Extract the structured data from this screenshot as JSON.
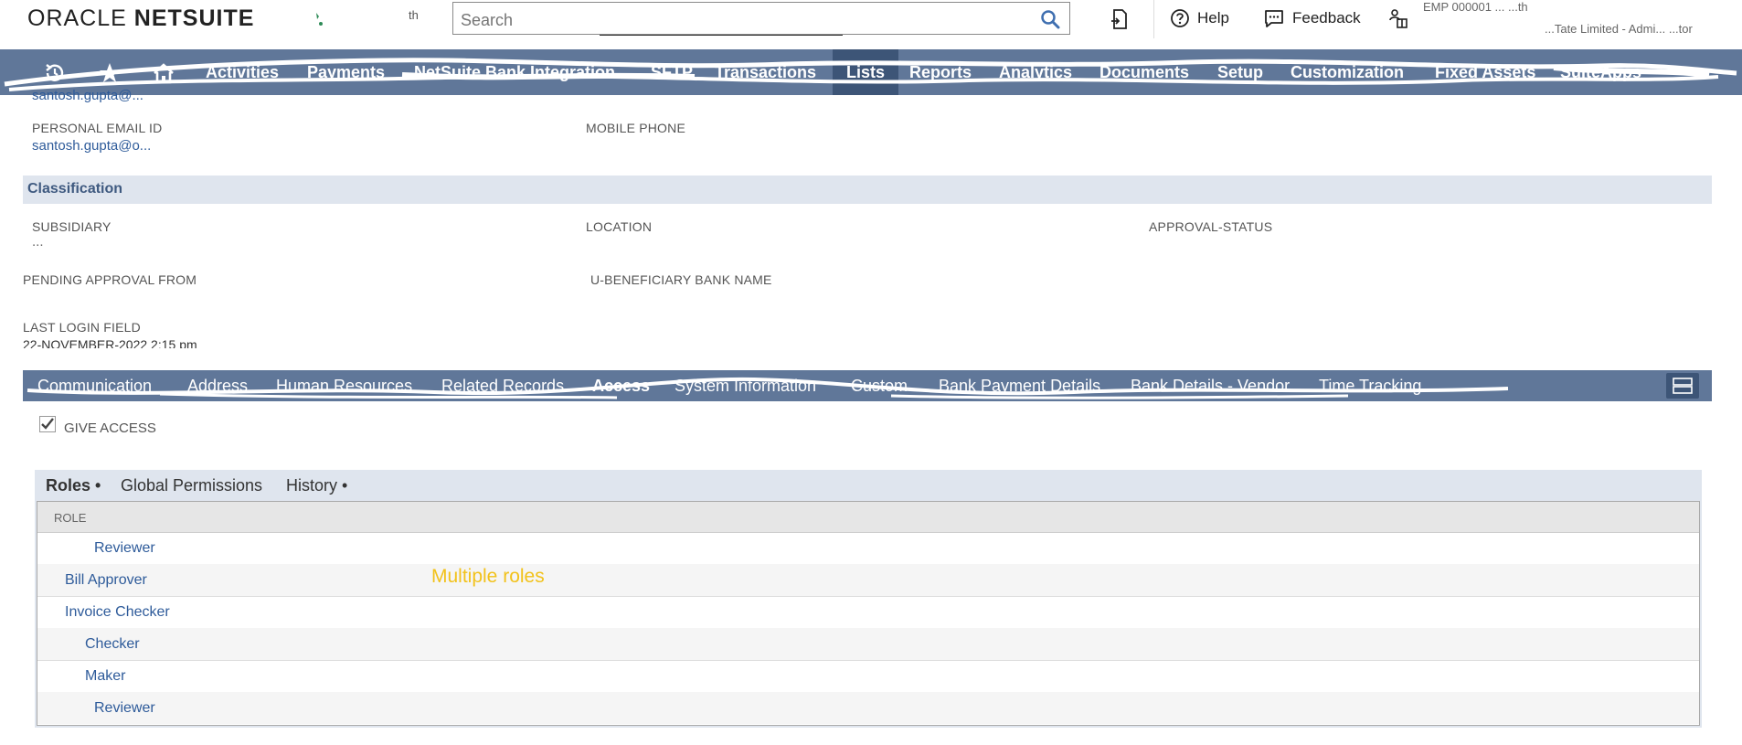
{
  "topbar": {
    "brand_regular": "ORACLE ",
    "brand_bold": "NETSUITE",
    "small_text": "th",
    "search_placeholder": "Search",
    "help_label": "Help",
    "feedback_label": "Feedback",
    "user_line1": "EMP 000001 ... ...th",
    "user_line2": "...Tate Limited - Admi... ...tor"
  },
  "nav": {
    "items": [
      "Activities",
      "Payments",
      "NetSuite Bank Integration",
      "SFTP",
      "Transactions",
      "Lists",
      "Reports",
      "Analytics",
      "Documents",
      "Setup",
      "Customization",
      "Fixed Assets",
      "SuiteApps"
    ],
    "active": "Lists",
    "more_label": "•••"
  },
  "fields": {
    "email_value_top": "santosh.gupta@...",
    "personal_email_label": "PERSONAL EMAIL ID",
    "personal_email_value": "santosh.gupta@o...",
    "mobile_phone_label": "MOBILE PHONE",
    "classification_label": "Classification",
    "subsidiary_label": "SUBSIDIARY",
    "subsidiary_value": "...",
    "location_label": "LOCATION",
    "approval_status_label": "APPROVAL-STATUS",
    "pending_approval_label": "PENDING APPROVAL FROM",
    "beneficiary_bank_label": "U-BENEFICIARY BANK NAME",
    "last_login_label": "LAST LOGIN FIELD",
    "last_login_value": "22-NOVEMBER-2022 2:15 pm"
  },
  "subtabs": {
    "items": [
      "Communication",
      "Address",
      "Human Resources",
      "Related Records",
      "Access",
      "System Information",
      "Custom",
      "Bank Payment Details",
      "Bank Details - Vendor",
      "Time Tracking"
    ],
    "active": "Access"
  },
  "access": {
    "give_access_label": "GIVE ACCESS",
    "give_access_checked": true,
    "panel_tabs": [
      "Roles •",
      "Global Permissions",
      "History •"
    ],
    "active_panel_tab": "Roles •",
    "role_column_header": "ROLE",
    "roles": [
      "Reviewer",
      "Bill Approver",
      "Invoice Checker",
      "Checker",
      "Maker",
      "Reviewer"
    ],
    "note": "Multiple roles"
  },
  "colors": {
    "nav_bg": "#607799",
    "nav_active": "#3d5577",
    "section_bg": "#dfe5ee",
    "link": "#2e5b9a",
    "note": "#f2c21b"
  }
}
